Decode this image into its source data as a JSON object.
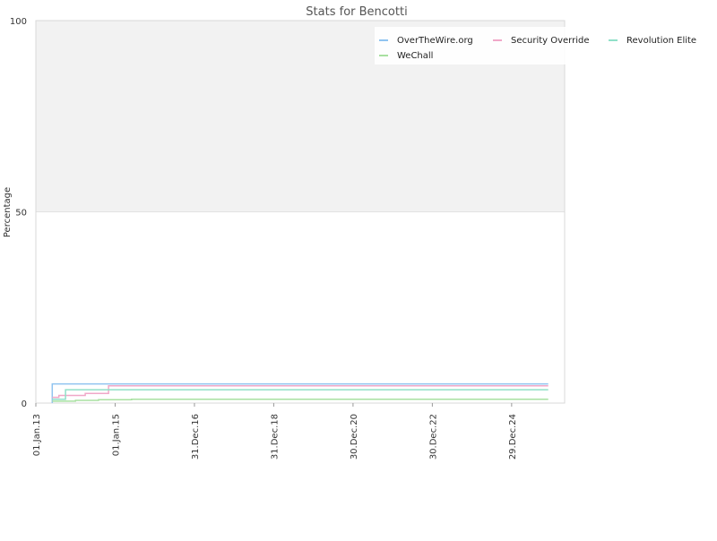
{
  "chart_data": {
    "type": "line",
    "title": "Stats for Bencotti",
    "xlabel": "",
    "ylabel": "Percentage",
    "ylim": [
      0,
      100
    ],
    "xlim": [
      "2013-01-01",
      "2026-05-01"
    ],
    "yticks": [
      0,
      50,
      100
    ],
    "xticks": [
      {
        "label": "01.Jan.13",
        "date": "2013-01-01"
      },
      {
        "label": "01.Jan.15",
        "date": "2015-01-01"
      },
      {
        "label": "31.Dec.16",
        "date": "2016-12-31"
      },
      {
        "label": "31.Dec.18",
        "date": "2018-12-31"
      },
      {
        "label": "30.Dec.20",
        "date": "2020-12-30"
      },
      {
        "label": "30.Dec.22",
        "date": "2022-12-30"
      },
      {
        "label": "29.Dec.24",
        "date": "2024-12-29"
      }
    ],
    "shaded_band": [
      50,
      100
    ],
    "legend_position": "top-right",
    "step": true,
    "series": [
      {
        "name": "OverTheWire.org",
        "color": "#90c4f0",
        "points": [
          [
            "2013-06-01",
            0
          ],
          [
            "2013-06-01",
            5
          ],
          [
            "2025-12-01",
            5
          ]
        ]
      },
      {
        "name": "Security Override",
        "color": "#f0a8c8",
        "points": [
          [
            "2013-06-01",
            1.5
          ],
          [
            "2013-08-01",
            2
          ],
          [
            "2013-11-01",
            2
          ],
          [
            "2014-04-01",
            2.5
          ],
          [
            "2014-11-01",
            2.5
          ],
          [
            "2014-11-01",
            4.5
          ],
          [
            "2025-12-01",
            4.5
          ]
        ]
      },
      {
        "name": "Revolution Elite",
        "color": "#90e0c8",
        "points": [
          [
            "2013-06-01",
            1
          ],
          [
            "2013-10-01",
            1
          ],
          [
            "2013-10-01",
            3.5
          ],
          [
            "2025-12-01",
            3.5
          ]
        ]
      },
      {
        "name": "WeChall",
        "color": "#a8e0a0",
        "points": [
          [
            "2013-06-01",
            0.5
          ],
          [
            "2014-01-01",
            0.7
          ],
          [
            "2014-08-01",
            0.9
          ],
          [
            "2015-06-01",
            1
          ],
          [
            "2025-12-01",
            1
          ]
        ]
      }
    ]
  }
}
